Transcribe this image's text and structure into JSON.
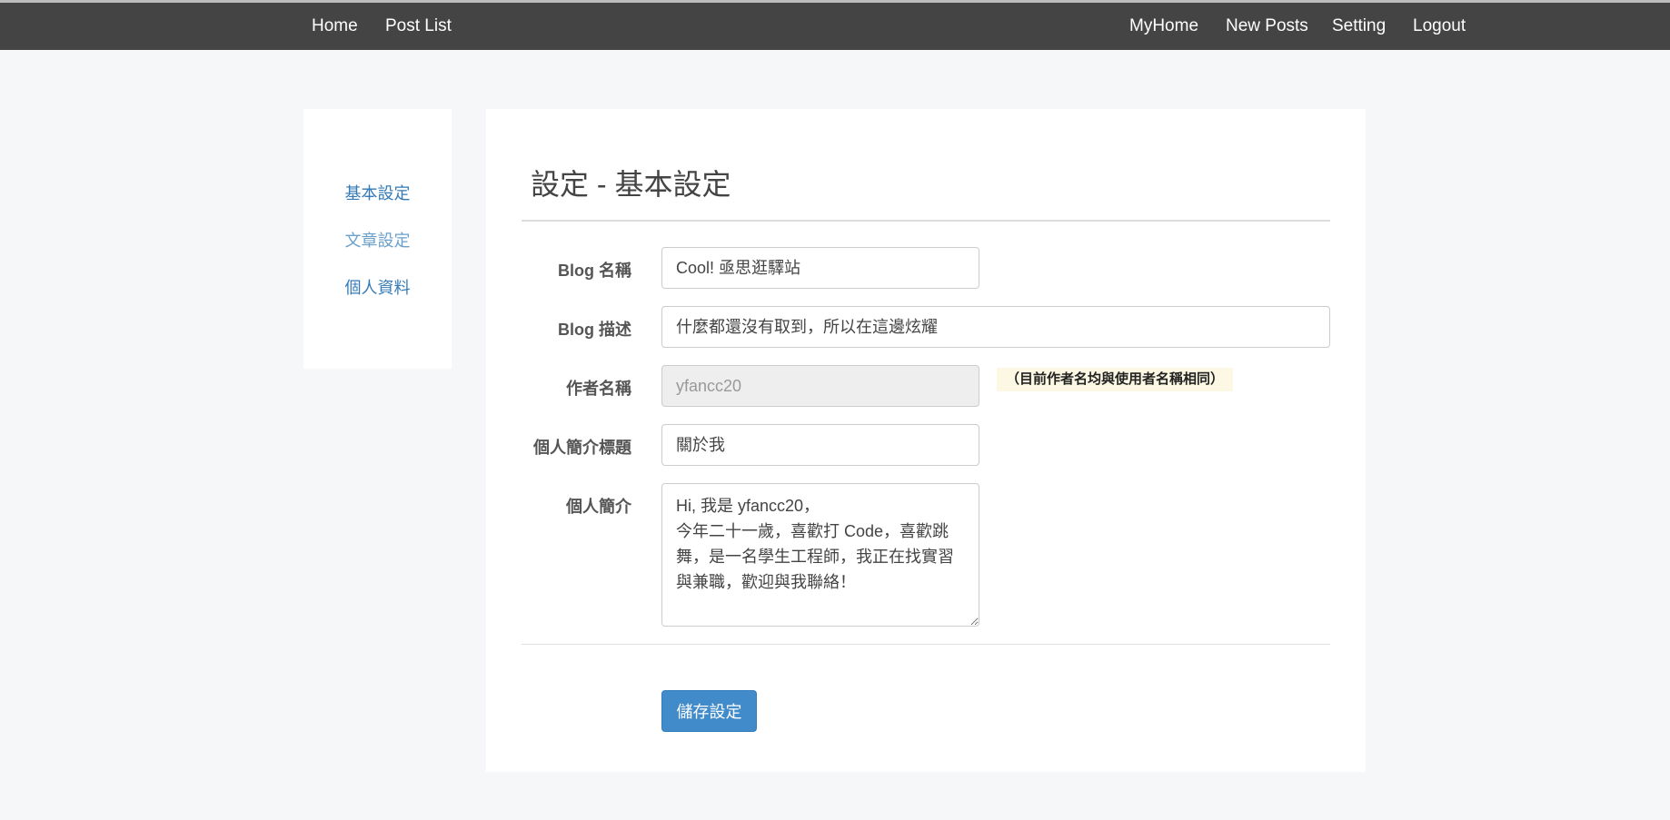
{
  "nav": {
    "left": [
      "Home",
      "Post List"
    ],
    "right": [
      "MyHome",
      "New Posts",
      "Setting",
      "Logout"
    ]
  },
  "sidebar": {
    "items": [
      {
        "label": "基本設定"
      },
      {
        "label": "文章設定"
      },
      {
        "label": "個人資料"
      }
    ]
  },
  "main": {
    "title": "設定 - 基本設定",
    "fields": {
      "blog_name": {
        "label": "Blog 名稱",
        "value": "Cool! 亟思逛驛站"
      },
      "blog_desc": {
        "label": "Blog 描述",
        "value": "什麼都還沒有取到，所以在這邊炫耀"
      },
      "author": {
        "label": "作者名稱",
        "value": "yfancc20",
        "note": "（目前作者名均與使用者名稱相同）"
      },
      "bio_title": {
        "label": "個人簡介標題",
        "value": "關於我"
      },
      "bio": {
        "label": "個人簡介",
        "value": "Hi, 我是 yfancc20，\n今年二十一歲，喜歡打 Code，喜歡跳舞，是一名學生工程師，我正在找實習與兼職，歡迎與我聯絡！"
      }
    },
    "save_label": "儲存設定"
  },
  "colors": {
    "navbar_bg": "#444444",
    "link": "#337ab7",
    "primary_button": "#428bca",
    "note_bg": "#fcf8e3"
  }
}
